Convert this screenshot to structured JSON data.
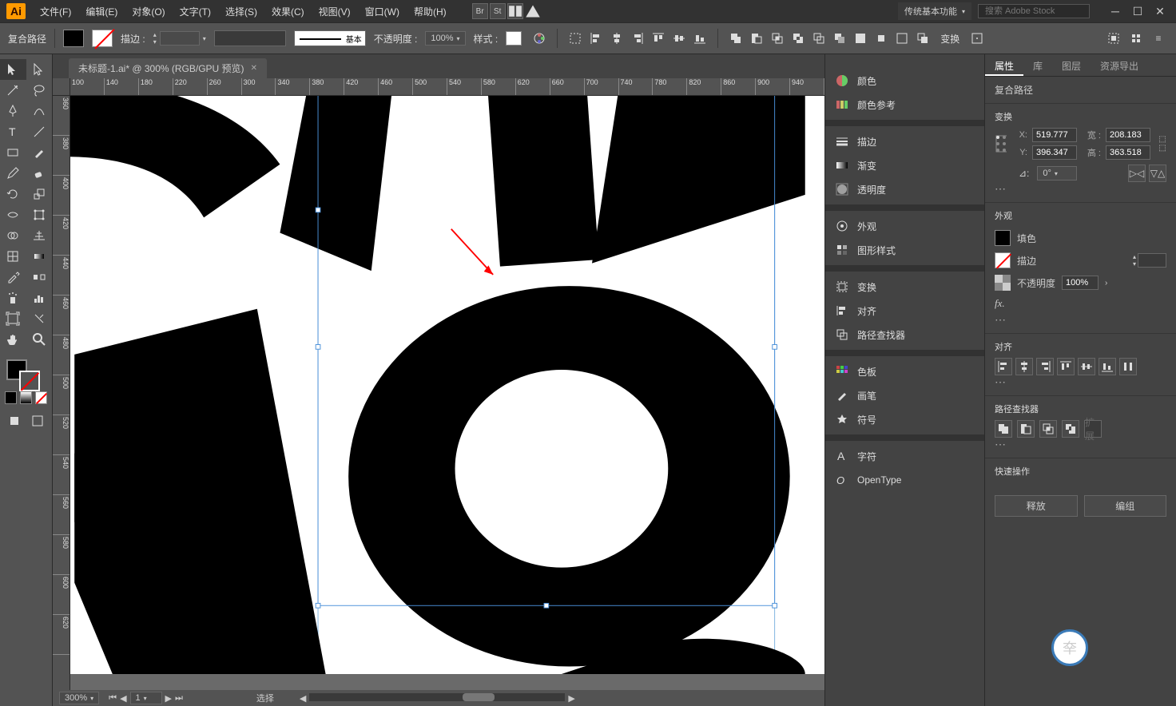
{
  "menubar": {
    "items": [
      "文件(F)",
      "编辑(E)",
      "对象(O)",
      "文字(T)",
      "选择(S)",
      "效果(C)",
      "视图(V)",
      "窗口(W)",
      "帮助(H)"
    ],
    "workspace": "传统基本功能",
    "stock_placeholder": "搜索 Adobe Stock"
  },
  "options_bar": {
    "selection_label": "复合路径",
    "stroke_label": "描边 :",
    "stroke_width": "",
    "brush_label": "基本",
    "opacity_label": "不透明度 :",
    "opacity_value": "100%",
    "style_label": "样式 :",
    "transform_label": "变换"
  },
  "document": {
    "tab_title": "未标题-1.ai* @ 300% (RGB/GPU 预览)",
    "ruler_h": [
      "100",
      "140",
      "180",
      "220",
      "260",
      "300",
      "340",
      "380",
      "420",
      "460",
      "500",
      "540",
      "580",
      "620",
      "660",
      "700",
      "740",
      "780",
      "820",
      "860",
      "900",
      "940"
    ],
    "ruler_v": [
      "360",
      "380",
      "400",
      "420",
      "440",
      "460",
      "480",
      "500",
      "520",
      "540",
      "560",
      "580",
      "600",
      "620"
    ]
  },
  "status": {
    "zoom": "300%",
    "artboard_nav": "1",
    "tool": "选择"
  },
  "mid_panels": {
    "group1": [
      "颜色",
      "颜色参考"
    ],
    "group2": [
      "描边",
      "渐变",
      "透明度"
    ],
    "group3": [
      "外观",
      "图形样式"
    ],
    "group4": [
      "变换",
      "对齐",
      "路径查找器"
    ],
    "group5": [
      "色板",
      "画笔",
      "符号"
    ],
    "group6": [
      "字符",
      "OpenType"
    ]
  },
  "right_panel": {
    "tabs": [
      "属性",
      "库",
      "图层",
      "资源导出"
    ],
    "object_type": "复合路径",
    "transform_title": "变换",
    "x_label": "X:",
    "y_label": "Y:",
    "w_label": "宽 :",
    "h_label": "高 :",
    "x": "519.777",
    "y": "396.347",
    "w": "208.183",
    "h": "363.518",
    "angle_label": "⊿:",
    "angle": "0°",
    "appearance_title": "外观",
    "fill_label": "填色",
    "stroke_label": "描边",
    "opacity_label": "不透明度",
    "opacity": "100%",
    "fx_label": "fx.",
    "align_title": "对齐",
    "pathfinder_title": "路径查找器",
    "quick_title": "快速操作",
    "quick_actions": [
      "释放",
      "编组"
    ]
  }
}
